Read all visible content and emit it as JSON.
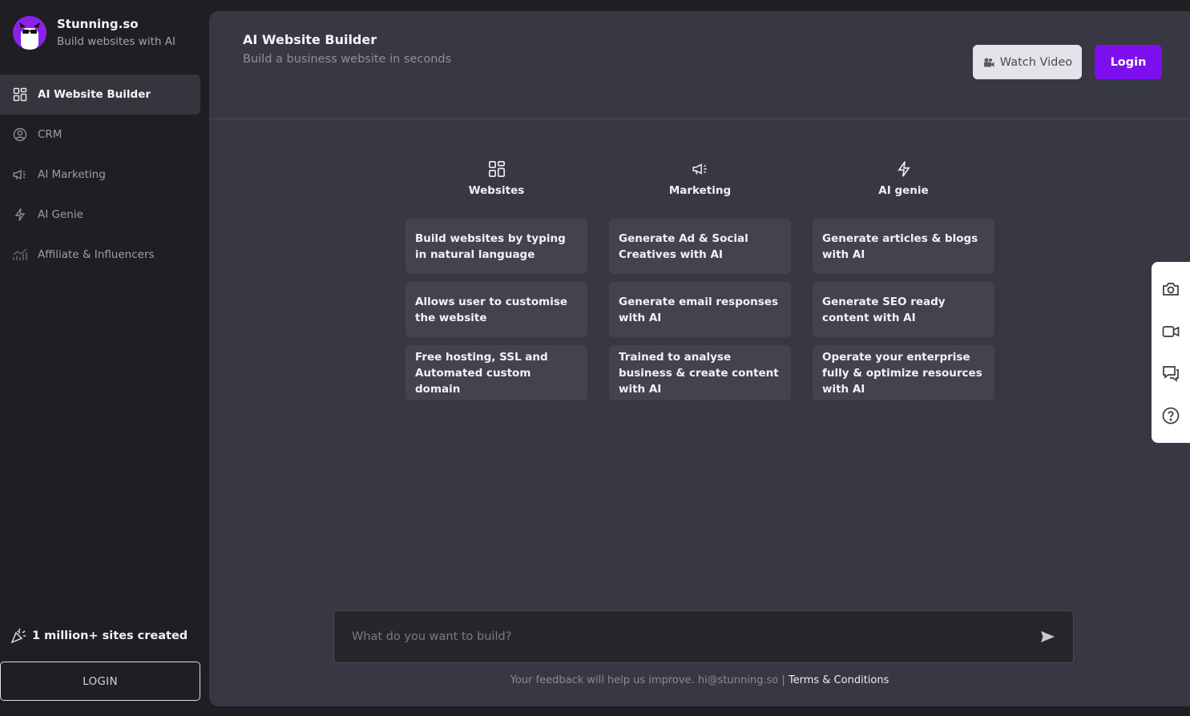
{
  "brand": {
    "name": "Stunning.so",
    "tagline": "Build websites with AI"
  },
  "sidebar": {
    "items": [
      {
        "label": "AI Website Builder",
        "icon": "grid-icon",
        "active": true
      },
      {
        "label": "CRM",
        "icon": "user-circle-icon",
        "active": false
      },
      {
        "label": "AI Marketing",
        "icon": "megaphone-icon",
        "active": false
      },
      {
        "label": "AI Genie",
        "icon": "lightning-icon",
        "active": false
      },
      {
        "label": "Affiliate & Influencers",
        "icon": "chart-icon",
        "active": false
      }
    ],
    "sites_created": "1 million+ sites created",
    "login_label": "LOGIN"
  },
  "header": {
    "title": "AI Website Builder",
    "subtitle": "Build a business website in seconds",
    "watch_video_label": "Watch Video",
    "login_label": "Login"
  },
  "columns": [
    {
      "title": "Websites",
      "icon": "grid-icon",
      "cards": [
        "Build websites by typing in natural language",
        "Allows user to customise the website",
        "Free hosting, SSL and Automated custom domain"
      ]
    },
    {
      "title": "Marketing",
      "icon": "megaphone-icon",
      "cards": [
        "Generate Ad & Social Creatives with AI",
        "Generate email responses with AI",
        "Trained to analyse business & create content with AI"
      ]
    },
    {
      "title": "AI genie",
      "icon": "lightning-icon",
      "cards": [
        "Generate articles & blogs with AI",
        "Generate SEO ready content with AI",
        "Operate your enterprise fully & optimize resources with AI"
      ]
    }
  ],
  "prompt": {
    "placeholder": "What do you want to build?",
    "value": ""
  },
  "footer": {
    "feedback": "Your feedback will help us improve. hi@stunning.so |",
    "terms": "Terms & Conditions"
  },
  "toolbar": {
    "tools": [
      "camera-icon",
      "video-icon",
      "chat-icon",
      "help-icon"
    ]
  },
  "colors": {
    "accent": "#7d0ef0",
    "panel": "#383844",
    "card": "#43434f",
    "background": "#1f1f23"
  }
}
